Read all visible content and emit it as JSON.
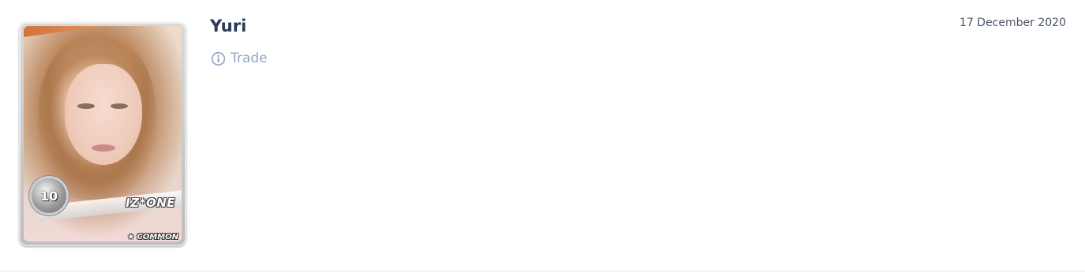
{
  "entry": {
    "name": "Yuri",
    "date": "17 December 2020",
    "action": {
      "label": "Trade",
      "icon": "info-circle-icon",
      "color": "#93a7c6"
    },
    "card": {
      "level": "10",
      "group": "IZ*ONE",
      "rarity": "COMMON",
      "rarity_icon": "star-icon"
    }
  },
  "colors": {
    "name": "#2b3a55",
    "date": "#4a5568",
    "divider": "#dde3ea"
  }
}
